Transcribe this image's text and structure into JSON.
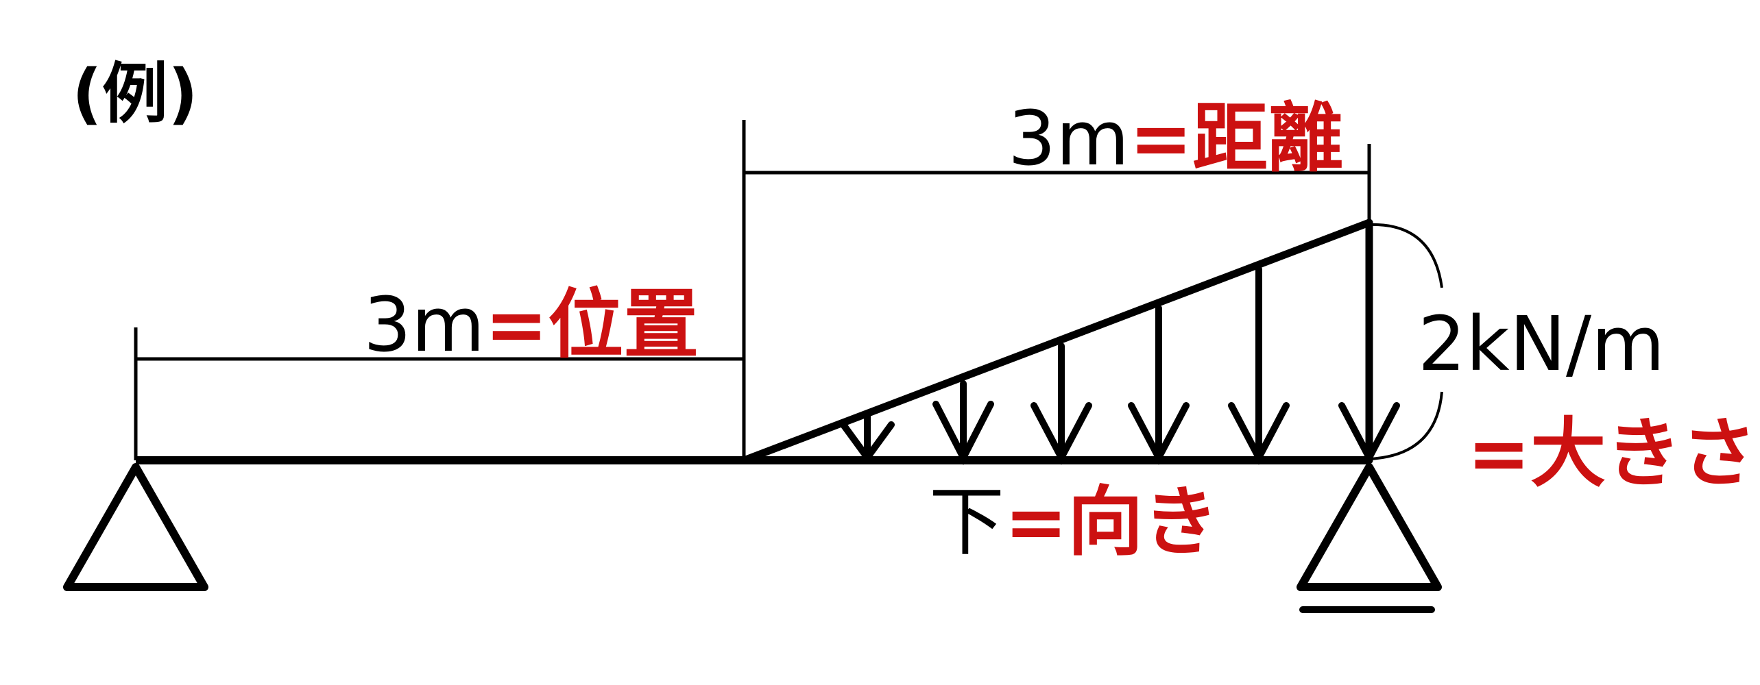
{
  "example_label": "(例)",
  "left_dimension": {
    "value_text": "3m",
    "meaning_text": "=位置"
  },
  "right_dimension": {
    "value_text": "3m",
    "meaning_text": "=距離"
  },
  "magnitude": {
    "value_text": "2kN/m",
    "meaning_text": "=大きさ"
  },
  "direction": {
    "value_text": "下",
    "meaning_text": "=向き"
  },
  "colors": {
    "black": "#000000",
    "red": "#cc1111"
  }
}
